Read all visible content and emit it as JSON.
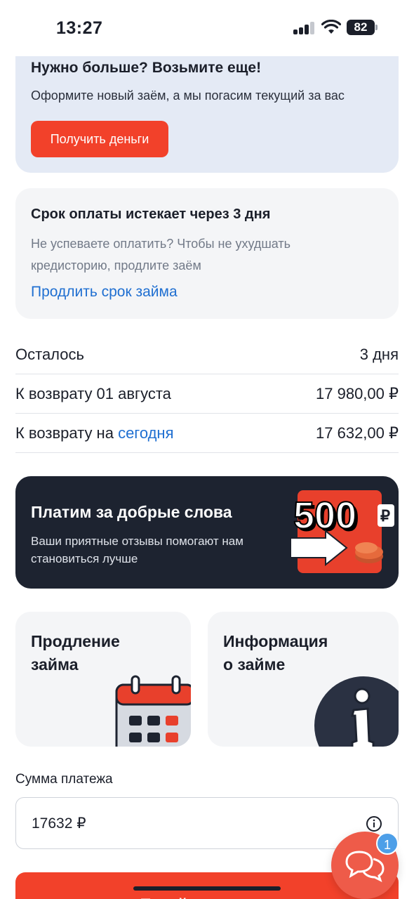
{
  "status_bar": {
    "time": "13:27",
    "battery": "82"
  },
  "promo_card": {
    "title": "Нужно больше? Возьмите еще!",
    "subtitle": "Оформите новый заём, а мы погасим текущий за вас",
    "button": "Получить деньги"
  },
  "deadline_card": {
    "title": "Срок оплаты истекает через 3 дня",
    "text": "Не успеваете оплатить? Чтобы не ухудшать кредисторию, продлите заём",
    "link": "Продлить срок займа"
  },
  "summary": {
    "rows": [
      {
        "label": "Осталось",
        "label_link": "",
        "value": "3 дня"
      },
      {
        "label": "К возврату 01 августа",
        "label_link": "",
        "value": "17 980,00 ₽"
      },
      {
        "label": "К возврату на ",
        "label_link": "сегодня",
        "value": "17 632,00 ₽"
      }
    ]
  },
  "banner": {
    "title": "Платим за добрые слова",
    "text": "Ваши приятные отзывы помогают нам становиться лучше",
    "amount": "500",
    "currency": "₽"
  },
  "tiles": [
    {
      "title_line1": "Продление",
      "title_line2": "займа"
    },
    {
      "title_line1": "Информация",
      "title_line2": "о займе"
    }
  ],
  "payment": {
    "label": "Сумма платежа",
    "value": "17632 ₽",
    "button": "Перейти к оплате"
  },
  "chat": {
    "badge": "1"
  },
  "colors": {
    "accent": "#f2412a",
    "link": "#1f6fd1",
    "dark": "#1d2330",
    "light_blue": "#e4eaf5"
  }
}
